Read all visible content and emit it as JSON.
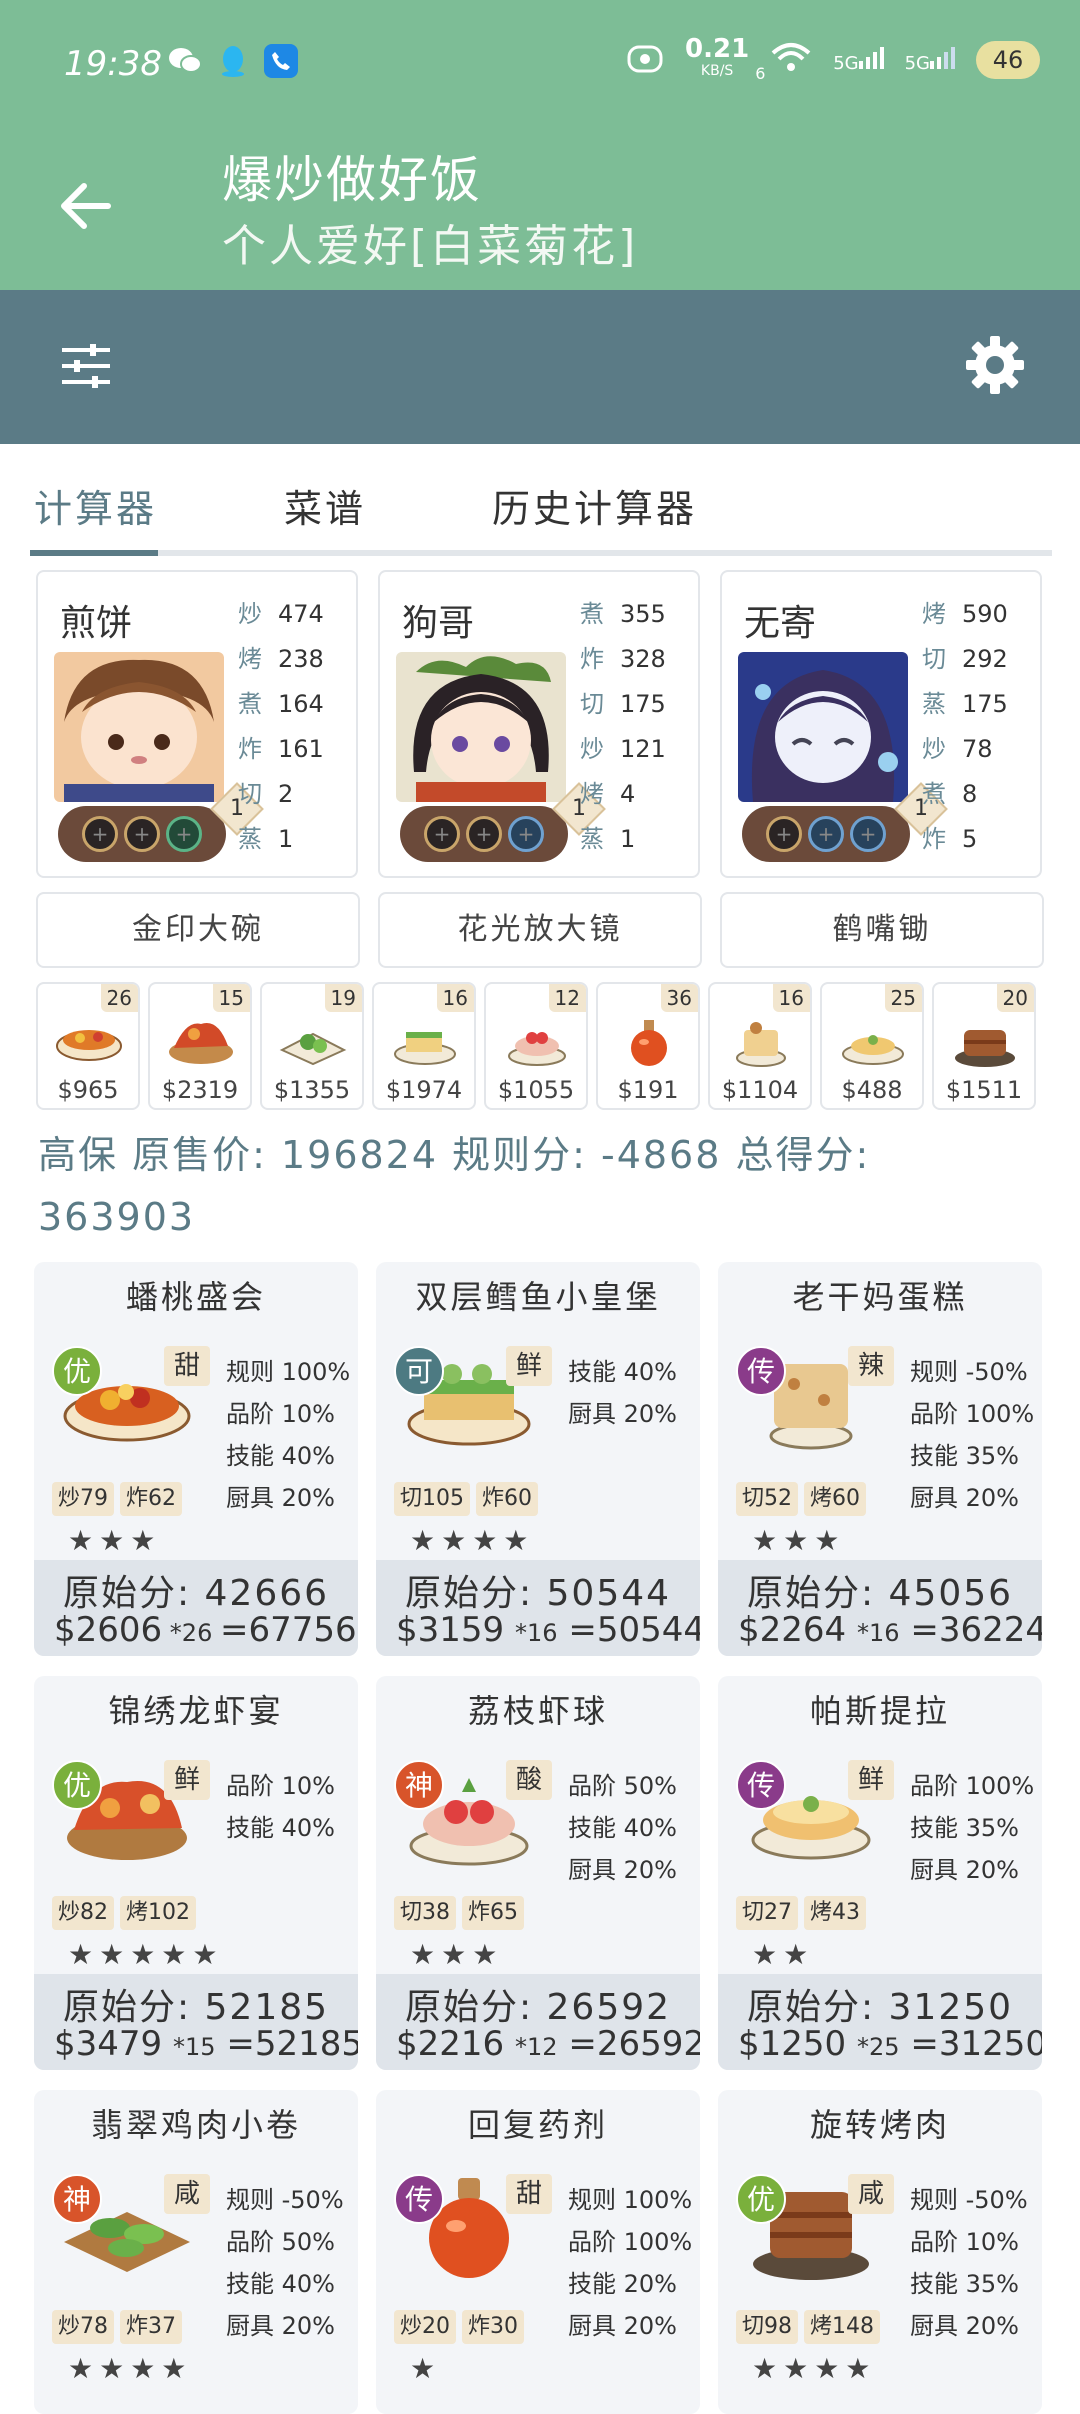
{
  "status_bar": {
    "time": "19:38",
    "net_speed": "0.21",
    "net_unit": "KB/S",
    "wifi_num": "6",
    "sig1": "5G",
    "sig2": "5G",
    "battery": "46"
  },
  "header": {
    "title": "爆炒做好饭",
    "subtitle": "个人爱好[白菜菊花]"
  },
  "tabs": [
    {
      "label": "计算器"
    },
    {
      "label": "菜谱"
    },
    {
      "label": "历史计算器"
    }
  ],
  "chefs": [
    {
      "name": "煎饼",
      "level": "1",
      "skills": [
        {
          "k": "炒",
          "v": "474"
        },
        {
          "k": "烤",
          "v": "238"
        },
        {
          "k": "煮",
          "v": "164"
        },
        {
          "k": "炸",
          "v": "161"
        },
        {
          "k": "切",
          "v": "2"
        },
        {
          "k": "蒸",
          "v": "1"
        }
      ]
    },
    {
      "name": "狗哥",
      "level": "1",
      "skills": [
        {
          "k": "煮",
          "v": "355"
        },
        {
          "k": "炸",
          "v": "328"
        },
        {
          "k": "切",
          "v": "175"
        },
        {
          "k": "炒",
          "v": "121"
        },
        {
          "k": "烤",
          "v": "4"
        },
        {
          "k": "蒸",
          "v": "1"
        }
      ]
    },
    {
      "name": "无寄",
      "level": "1",
      "skills": [
        {
          "k": "烤",
          "v": "590"
        },
        {
          "k": "切",
          "v": "292"
        },
        {
          "k": "蒸",
          "v": "175"
        },
        {
          "k": "炒",
          "v": "78"
        },
        {
          "k": "煮",
          "v": "8"
        },
        {
          "k": "炸",
          "v": "5"
        }
      ]
    }
  ],
  "equipment": [
    "金印大碗",
    "花光放大镜",
    "鹤嘴锄"
  ],
  "dishes": [
    {
      "qty": "26",
      "price": "$965"
    },
    {
      "qty": "15",
      "price": "$2319"
    },
    {
      "qty": "19",
      "price": "$1355"
    },
    {
      "qty": "16",
      "price": "$1974"
    },
    {
      "qty": "12",
      "price": "$1055"
    },
    {
      "qty": "36",
      "price": "$191"
    },
    {
      "qty": "16",
      "price": "$1104"
    },
    {
      "qty": "25",
      "price": "$488"
    },
    {
      "qty": "20",
      "price": "$1511"
    }
  ],
  "summary": {
    "line1": "高保 原售价: 196824 规则分: -4868 总得分:",
    "line2": "363903"
  },
  "recipes": [
    {
      "name": "蟠桃盛会",
      "rank": "优",
      "rank_color": "#7ab03c",
      "flavor": "甜",
      "bonus": [
        "规则 100%",
        "品阶 10%",
        "技能 40%",
        "厨具 20%"
      ],
      "reqs": [
        {
          "k": "炒",
          "v": "79"
        },
        {
          "k": "炸",
          "v": "62"
        }
      ],
      "stars": "★★★",
      "raw": "原始分: 42666",
      "calc_price": "$2606",
      "calc_mul": "*26",
      "calc_total": "=67756"
    },
    {
      "name": "双层鳕鱼小皇堡",
      "rank": "可",
      "rank_color": "#4d7a82",
      "flavor": "鲜",
      "bonus": [
        "技能 40%",
        "厨具 20%"
      ],
      "reqs": [
        {
          "k": "切",
          "v": "105"
        },
        {
          "k": "炸",
          "v": "60"
        }
      ],
      "stars": "★★★★",
      "raw": "原始分: 50544",
      "calc_price": "$3159",
      "calc_mul": "*16",
      "calc_total": "=50544"
    },
    {
      "name": "老干妈蛋糕",
      "rank": "传",
      "rank_color": "#8a3b8a",
      "flavor": "辣",
      "bonus": [
        "规则 -50%",
        "品阶 100%",
        "技能 35%",
        "厨具 20%"
      ],
      "reqs": [
        {
          "k": "切",
          "v": "52"
        },
        {
          "k": "烤",
          "v": "60"
        }
      ],
      "stars": "★★★",
      "raw": "原始分: 45056",
      "calc_price": "$2264",
      "calc_mul": "*16",
      "calc_total": "=36224"
    },
    {
      "name": "锦绣龙虾宴",
      "rank": "优",
      "rank_color": "#7ab03c",
      "flavor": "鲜",
      "bonus": [
        "品阶 10%",
        "技能 40%"
      ],
      "reqs": [
        {
          "k": "炒",
          "v": "82"
        },
        {
          "k": "烤",
          "v": "102"
        }
      ],
      "stars": "★★★★★",
      "raw": "原始分: 52185",
      "calc_price": "$3479",
      "calc_mul": "*15",
      "calc_total": "=52185"
    },
    {
      "name": "荔枝虾球",
      "rank": "神",
      "rank_color": "#d8542a",
      "flavor": "酸",
      "bonus": [
        "品阶 50%",
        "技能 40%",
        "厨具 20%"
      ],
      "reqs": [
        {
          "k": "切",
          "v": "38"
        },
        {
          "k": "炸",
          "v": "65"
        }
      ],
      "stars": "★★★",
      "raw": "原始分: 26592",
      "calc_price": "$2216",
      "calc_mul": "*12",
      "calc_total": "=26592"
    },
    {
      "name": "帕斯提拉",
      "rank": "传",
      "rank_color": "#8a3b8a",
      "flavor": "鲜",
      "bonus": [
        "品阶 100%",
        "技能 35%",
        "厨具 20%"
      ],
      "reqs": [
        {
          "k": "切",
          "v": "27"
        },
        {
          "k": "烤",
          "v": "43"
        }
      ],
      "stars": "★★",
      "raw": "原始分: 31250",
      "calc_price": "$1250",
      "calc_mul": "*25",
      "calc_total": "=31250"
    },
    {
      "name": "翡翠鸡肉小卷",
      "rank": "神",
      "rank_color": "#d8542a",
      "flavor": "咸",
      "bonus": [
        "规则 -50%",
        "品阶 50%",
        "技能 40%",
        "厨具 20%"
      ],
      "reqs": [
        {
          "k": "炒",
          "v": "78"
        },
        {
          "k": "炸",
          "v": "37"
        }
      ],
      "stars": "★★★★",
      "raw": "",
      "calc_price": "",
      "calc_mul": "",
      "calc_total": ""
    },
    {
      "name": "回复药剂",
      "rank": "传",
      "rank_color": "#8a3b8a",
      "flavor": "甜",
      "bonus": [
        "规则 100%",
        "品阶 100%",
        "技能 20%",
        "厨具 20%"
      ],
      "reqs": [
        {
          "k": "炒",
          "v": "20"
        },
        {
          "k": "炸",
          "v": "30"
        }
      ],
      "stars": "★",
      "raw": "",
      "calc_price": "",
      "calc_mul": "",
      "calc_total": ""
    },
    {
      "name": "旋转烤肉",
      "rank": "优",
      "rank_color": "#7ab03c",
      "flavor": "咸",
      "bonus": [
        "规则 -50%",
        "品阶 10%",
        "技能 35%",
        "厨具 20%"
      ],
      "reqs": [
        {
          "k": "切",
          "v": "98"
        },
        {
          "k": "烤",
          "v": "148"
        }
      ],
      "stars": "★★★★",
      "raw": "",
      "calc_price": "",
      "calc_mul": "",
      "calc_total": ""
    }
  ]
}
